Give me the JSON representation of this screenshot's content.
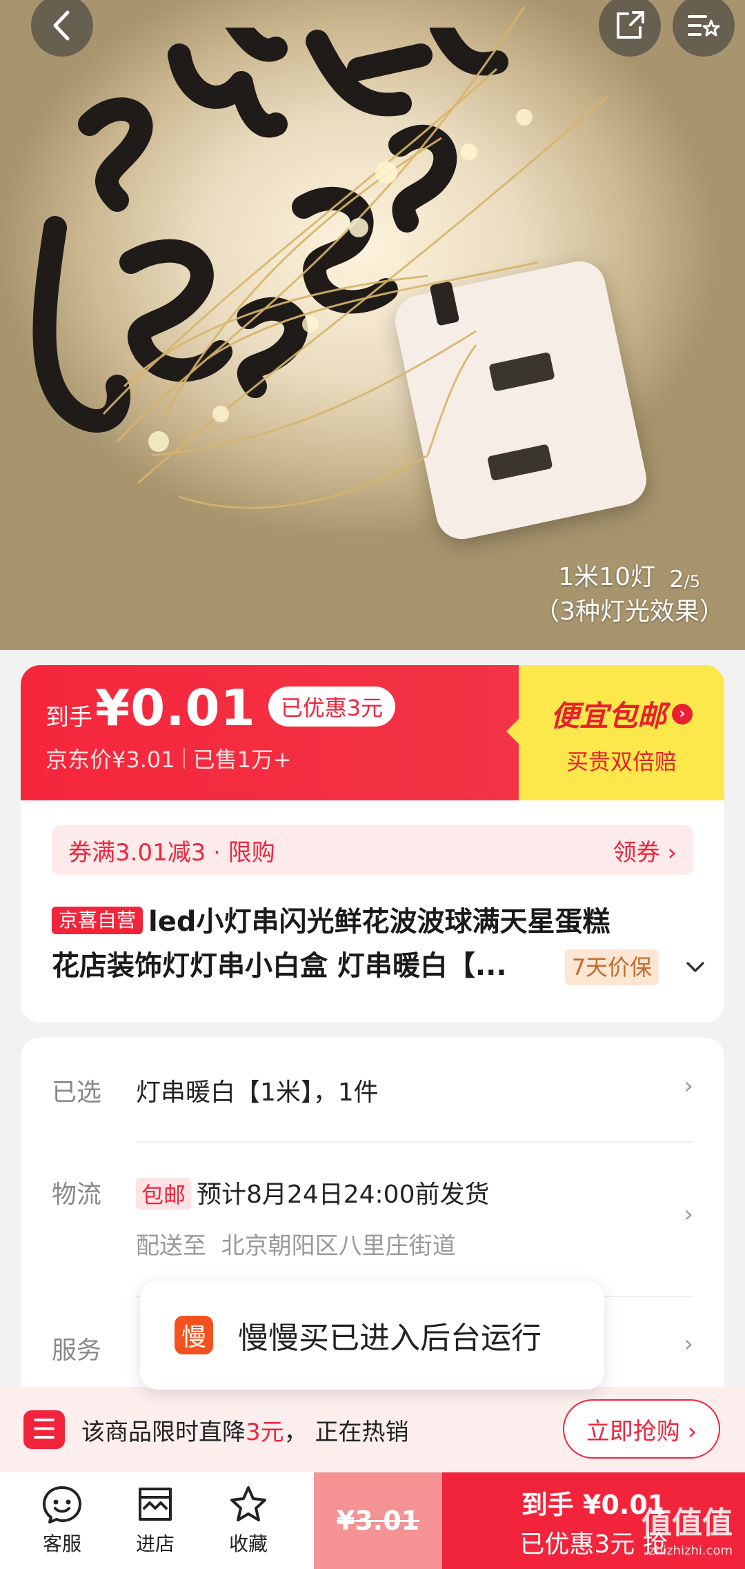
{
  "hero": {
    "caption_line1": "1米10灯",
    "caption_line2": "（3种灯光效果）",
    "pager_current": "2",
    "pager_total": "/5"
  },
  "price": {
    "prefix": "到手",
    "value": "¥0.01",
    "saved": "已优惠3元",
    "jd_price": "京东价¥3.01",
    "sold": "已售1万+",
    "promo_title": "便宜包邮",
    "promo_sub": "买贵双倍赔"
  },
  "coupon": {
    "text": "券满3.01减3 · 限购",
    "action": "领券 ›"
  },
  "product": {
    "tag": "京喜自营",
    "title_line1": "led小灯串闪光鲜花波波球满天星蛋糕",
    "title_line2": "花店装饰灯灯串小白盒 灯串暖白【...",
    "price_protect": "7天价保"
  },
  "options": {
    "selected_label": "已选",
    "selected_value": "灯串暖白【1米】，1件",
    "logistics_label": "物流",
    "freeship_tag": "包邮",
    "ship_time": "预计8月24日24:00前发货",
    "ship_to_label": "配送至",
    "ship_address": "北京朝阳区八里庄街道",
    "service_label": "服务"
  },
  "toast": {
    "icon_char": "慢",
    "text": "慢慢买已进入后台运行"
  },
  "hot": {
    "prefix": "该商品限时直降",
    "amount": "3元",
    "suffix": "，  正在热销",
    "button": "立即抢购 ›"
  },
  "bottom": {
    "service": "客服",
    "store": "进店",
    "favorite": "收藏",
    "orig_price": "¥3.01",
    "buy_line1": "到手 ¥0.01",
    "buy_line2": "已优惠3元 抢",
    "watermark": "值值值",
    "watermark_sub": "zhizhizhi.com"
  },
  "colors": {
    "brand_red": "#f2243b",
    "promo_yellow": "#fce84a"
  }
}
